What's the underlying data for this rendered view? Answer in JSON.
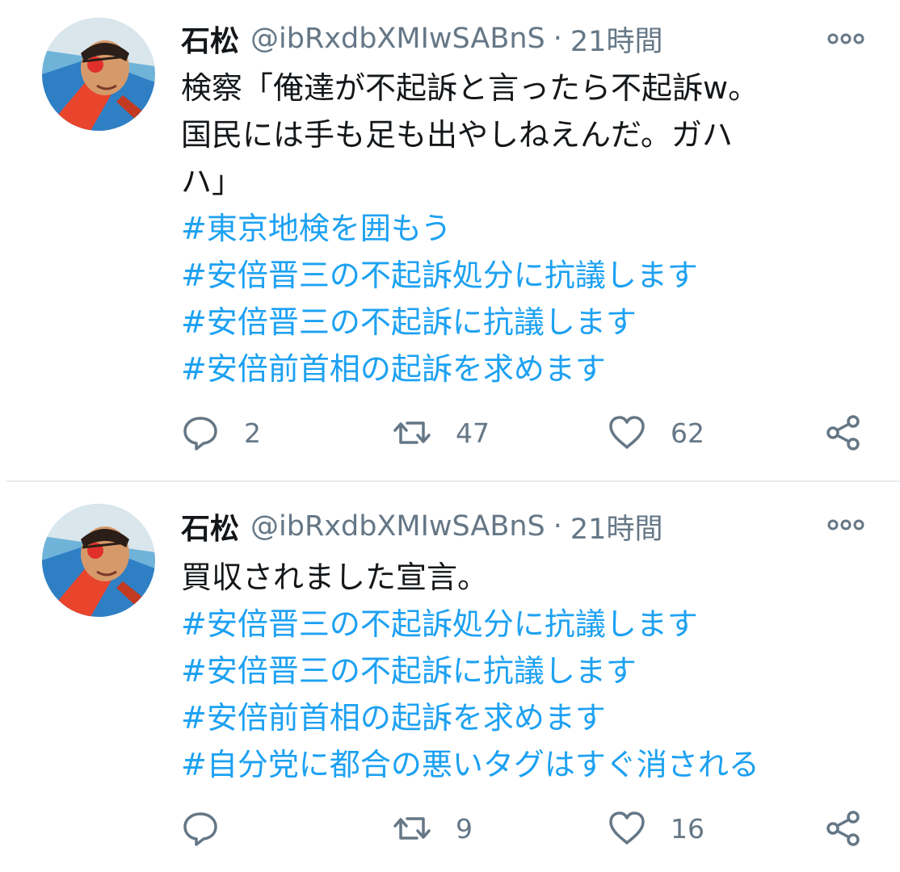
{
  "tweets": [
    {
      "display_name": "石松",
      "handle": "@ibRxdbXMIwSABnS",
      "separator": "·",
      "time": "21時間",
      "text_lines": [
        "検察「俺達が不起訴と言ったら不起訴w。",
        "国民には手も足も出やしねえんだ。ガハ",
        "ハ」"
      ],
      "hashtags": [
        "#東京地検を囲もう",
        "#安倍晋三の不起訴処分に抗議します",
        "#安倍晋三の不起訴に抗議します",
        "#安倍前首相の起訴を求めます"
      ],
      "replies": "2",
      "retweets": "47",
      "likes": "62"
    },
    {
      "display_name": "石松",
      "handle": "@ibRxdbXMIwSABnS",
      "separator": "·",
      "time": "21時間",
      "text_lines": [
        "買収されました宣言。"
      ],
      "hashtags": [
        "#安倍晋三の不起訴処分に抗議します",
        "#安倍晋三の不起訴に抗議します",
        "#安倍前首相の起訴を求めます",
        "#自分党に都合の悪いタグはすぐ消される"
      ],
      "replies": "",
      "retweets": "9",
      "likes": "16"
    }
  ],
  "colors": {
    "hashtag": "#1da1f2",
    "secondary_text": "#657786",
    "primary_text": "#14171a",
    "divider": "#e6ecf0"
  },
  "icons": {
    "avatar": "avatar",
    "more": "more-horizontal-icon",
    "reply": "reply-icon",
    "retweet": "retweet-icon",
    "like": "heart-icon",
    "share": "share-icon"
  }
}
